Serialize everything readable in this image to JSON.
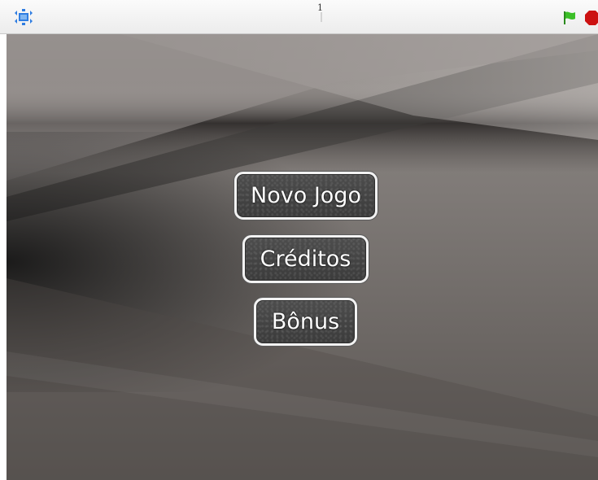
{
  "topbar": {
    "version_text": "1",
    "icons": {
      "fullscreen": "fullscreen-icon",
      "green_flag": "green-flag-icon",
      "stop": "stop-icon"
    },
    "colors": {
      "fullscreen_icon": "#2f7de1",
      "green_flag": "#3bbf27",
      "stop": "#cc1111"
    }
  },
  "stage": {
    "menu": {
      "buttons": [
        {
          "label": "Novo Jogo"
        },
        {
          "label": "Créditos"
        },
        {
          "label": "Bônus"
        }
      ]
    }
  }
}
